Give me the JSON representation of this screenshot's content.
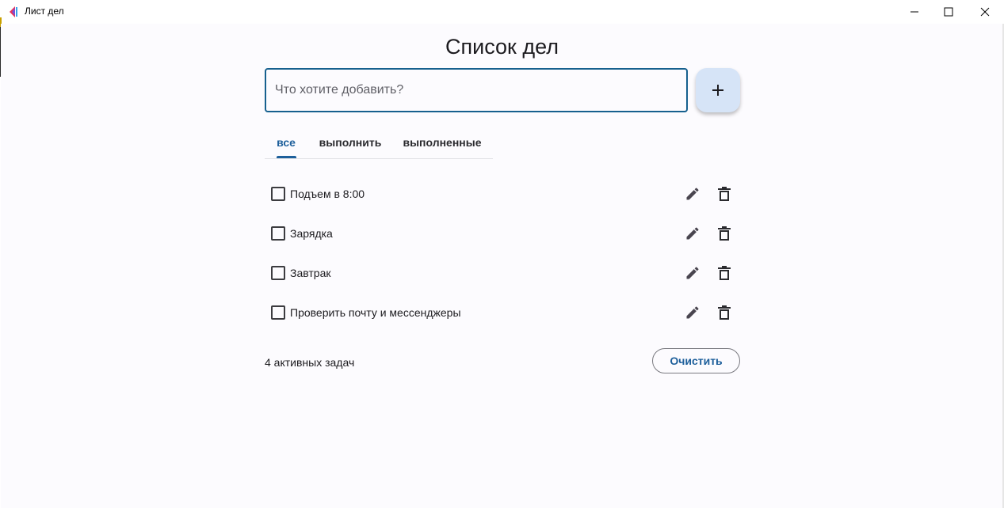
{
  "window": {
    "title": "Лист дел",
    "controls": [
      "minimize",
      "maximize",
      "close"
    ]
  },
  "page": {
    "title": "Список дел"
  },
  "input": {
    "placeholder": "Что хотите добавить?",
    "value": "",
    "add_icon": "plus-icon"
  },
  "tabs": [
    {
      "label": "все",
      "active": true
    },
    {
      "label": "выполнить",
      "active": false
    },
    {
      "label": "выполненные",
      "active": false
    }
  ],
  "tasks": [
    {
      "text": "Подъем в 8:00",
      "done": false
    },
    {
      "text": "Зарядка",
      "done": false
    },
    {
      "text": "Завтрак",
      "done": false
    },
    {
      "text": "Проверить почту и мессенджеры",
      "done": false
    }
  ],
  "footer": {
    "counter": "4 активных задач",
    "clear_label": "Очистить"
  },
  "colors": {
    "accent": "#1d5f9b",
    "input_border": "#16608e",
    "add_button_bg": "#d6e4f7",
    "background": "#fcfbfe"
  }
}
